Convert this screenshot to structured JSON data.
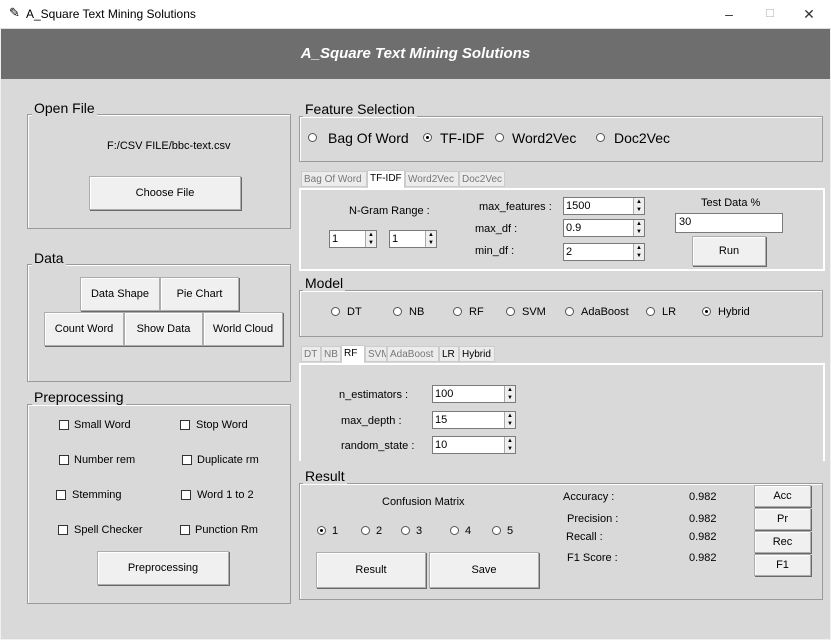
{
  "window": {
    "title": "A_Square Text Mining Solutions",
    "minimize": "–",
    "maximize": "☐",
    "close": "✕"
  },
  "banner": "A_Square Text Mining Solutions",
  "open_file": {
    "legend": "Open File",
    "path": "F:/CSV FILE/bbc-text.csv",
    "choose_button": "Choose File"
  },
  "data": {
    "legend": "Data",
    "buttons": [
      "Data Shape",
      "Pie Chart",
      "Count Word",
      "Show Data",
      "World Cloud"
    ]
  },
  "preprocessing": {
    "legend": "Preprocessing",
    "options": [
      "Small Word",
      "Stop Word",
      "Number rem",
      "Duplicate rm",
      "Stemming",
      "Word 1 to 2",
      "Spell Checker",
      "Punction Rm"
    ],
    "button": "Preprocessing"
  },
  "feature_selection": {
    "legend": "Feature Selection",
    "options": [
      "Bag Of Word",
      "TF-IDF",
      "Word2Vec",
      "Doc2Vec"
    ],
    "selected": "TF-IDF"
  },
  "feature_tabs": [
    "Bag Of Word",
    "TF-IDF",
    "Word2Vec",
    "Doc2Vec"
  ],
  "tfidf": {
    "ngram_label": "N-Gram Range :",
    "ngram_min": "1",
    "ngram_max": "1",
    "max_features_label": "max_features :",
    "max_features": "1500",
    "max_df_label": "max_df :",
    "max_df": "0.9",
    "min_df_label": "min_df :",
    "min_df": "2",
    "test_label": "Test Data %",
    "test_value": "30",
    "run_button": "Run"
  },
  "model": {
    "legend": "Model",
    "options": [
      "DT",
      "NB",
      "RF",
      "SVM",
      "AdaBoost",
      "LR",
      "Hybrid"
    ],
    "selected": "Hybrid"
  },
  "model_tabs": [
    "DT",
    "NB",
    "RF",
    "SVM",
    "AdaBoost",
    "LR",
    "Hybrid"
  ],
  "rf": {
    "n_estimators_label": "n_estimators :",
    "n_estimators": "100",
    "max_depth_label": "max_depth :",
    "max_depth": "15",
    "random_state_label": "random_state :",
    "random_state": "10"
  },
  "result": {
    "legend": "Result",
    "confusion_title": "Confusion Matrix",
    "cm_options": [
      "1",
      "2",
      "3",
      "4",
      "5"
    ],
    "cm_selected": "1",
    "result_button": "Result",
    "save_button": "Save",
    "metrics": [
      {
        "label": "Accuracy :",
        "value": "0.982",
        "button": "Acc"
      },
      {
        "label": "Precision :",
        "value": "0.982",
        "button": "Pr"
      },
      {
        "label": "Recall :",
        "value": "0.982",
        "button": "Rec"
      },
      {
        "label": "F1 Score :",
        "value": "0.982",
        "button": "F1"
      }
    ]
  }
}
